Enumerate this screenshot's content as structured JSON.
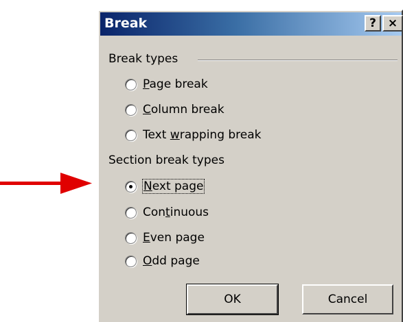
{
  "dialog": {
    "title": "Break",
    "help_button": "?",
    "close_button": "×"
  },
  "break_types": {
    "label": "Break types",
    "options": [
      {
        "prefix": "",
        "accel": "P",
        "rest": "age break",
        "checked": false
      },
      {
        "prefix": "",
        "accel": "C",
        "rest": "olumn break",
        "checked": false
      },
      {
        "prefix": "Text ",
        "accel": "w",
        "rest": "rapping break",
        "checked": false
      }
    ]
  },
  "section_break_types": {
    "label": "Section break types",
    "options": [
      {
        "prefix": "",
        "accel": "N",
        "rest": "ext page",
        "checked": true
      },
      {
        "prefix": "Con",
        "accel": "t",
        "rest": "inuous",
        "checked": false
      },
      {
        "prefix": "",
        "accel": "E",
        "rest": "ven page",
        "checked": false
      },
      {
        "prefix": "",
        "accel": "O",
        "rest": "dd page",
        "checked": false
      }
    ]
  },
  "buttons": {
    "ok": "OK",
    "cancel": "Cancel"
  },
  "annotation": {
    "arrow_color": "#e00000"
  }
}
